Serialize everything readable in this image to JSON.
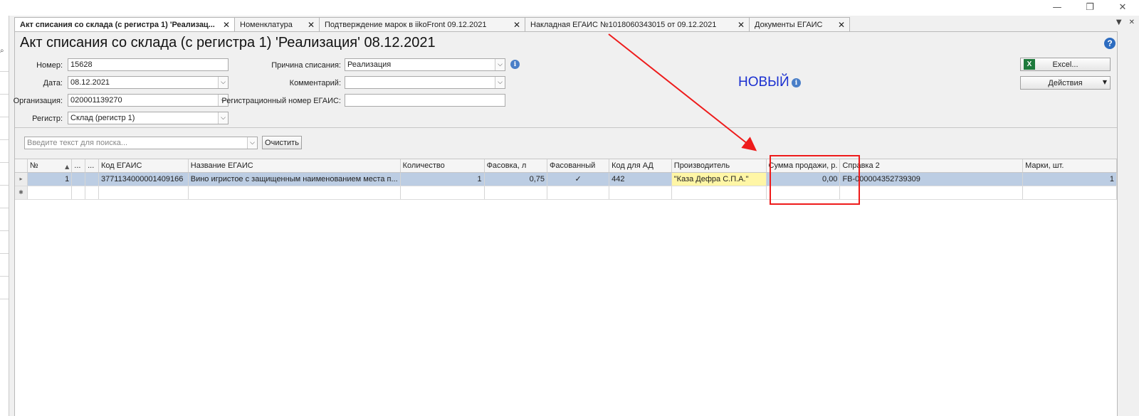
{
  "window": {
    "minimize": "—",
    "restore": "❐",
    "close": "✕"
  },
  "tabs": [
    {
      "label": "Акт списания со склада (с регистра 1) 'Реализац...",
      "close": "✕",
      "active": true
    },
    {
      "label": "Номенклатура",
      "close": "✕"
    },
    {
      "label": "Подтверждение марок в iikoFront 09.12.2021",
      "close": "✕"
    },
    {
      "label": "Накладная ЕГАИС №1018060343015 от 09.12.2021",
      "close": "✕"
    },
    {
      "label": "Документы ЕГАИС",
      "close": "✕"
    }
  ],
  "tab_menu": {
    "dropdown": "▼",
    "close": "✕"
  },
  "document": {
    "title": "Акт списания со склада (с регистра 1) 'Реализация' 08.12.2021",
    "status": "НОВЫЙ",
    "help": "?"
  },
  "form": {
    "number_label": "Номер:",
    "number_value": "15628",
    "date_label": "Дата:",
    "date_value": "08.12.2021",
    "org_label": "Организация:",
    "org_value": "020001139270",
    "register_label": "Регистр:",
    "register_value": "Склад (регистр 1)",
    "reason_label": "Причина списания:",
    "reason_value": "Реализация",
    "comment_label": "Комментарий:",
    "comment_value": "",
    "egais_reg_label": "Регистрационный номер ЕГАИС:",
    "egais_reg_value": ""
  },
  "buttons": {
    "excel": "Excel...",
    "actions": "Действия",
    "clear": "Очистить"
  },
  "search": {
    "placeholder": "Введите текст для поиска..."
  },
  "grid": {
    "columns": [
      "№",
      "...",
      "...",
      "Код ЕГАИС",
      "Название ЕГАИС",
      "Количество",
      "Фасовка, л",
      "Фасованный",
      "Код для АД",
      "Производитель",
      "Сумма продажи, р.",
      "Справка 2",
      "Марки, шт."
    ],
    "rows": [
      {
        "no": "1",
        "egais_code": "3771134000001409166",
        "egais_name": "Вино игристое с защищенным наименованием места п...",
        "quantity": "1",
        "volume": "0,75",
        "packaged": "✓",
        "ad_code": "442",
        "producer": "\"Каза Дефра С.П.А.\"",
        "sale_sum": "0,00",
        "certificate2": "FB-000004352739309",
        "marks": "1"
      }
    ]
  },
  "colors": {
    "annotation": "#ee1b1b",
    "selection": "#bccde3",
    "status": "#1a2fd0",
    "highlight": "#fff6a6"
  }
}
